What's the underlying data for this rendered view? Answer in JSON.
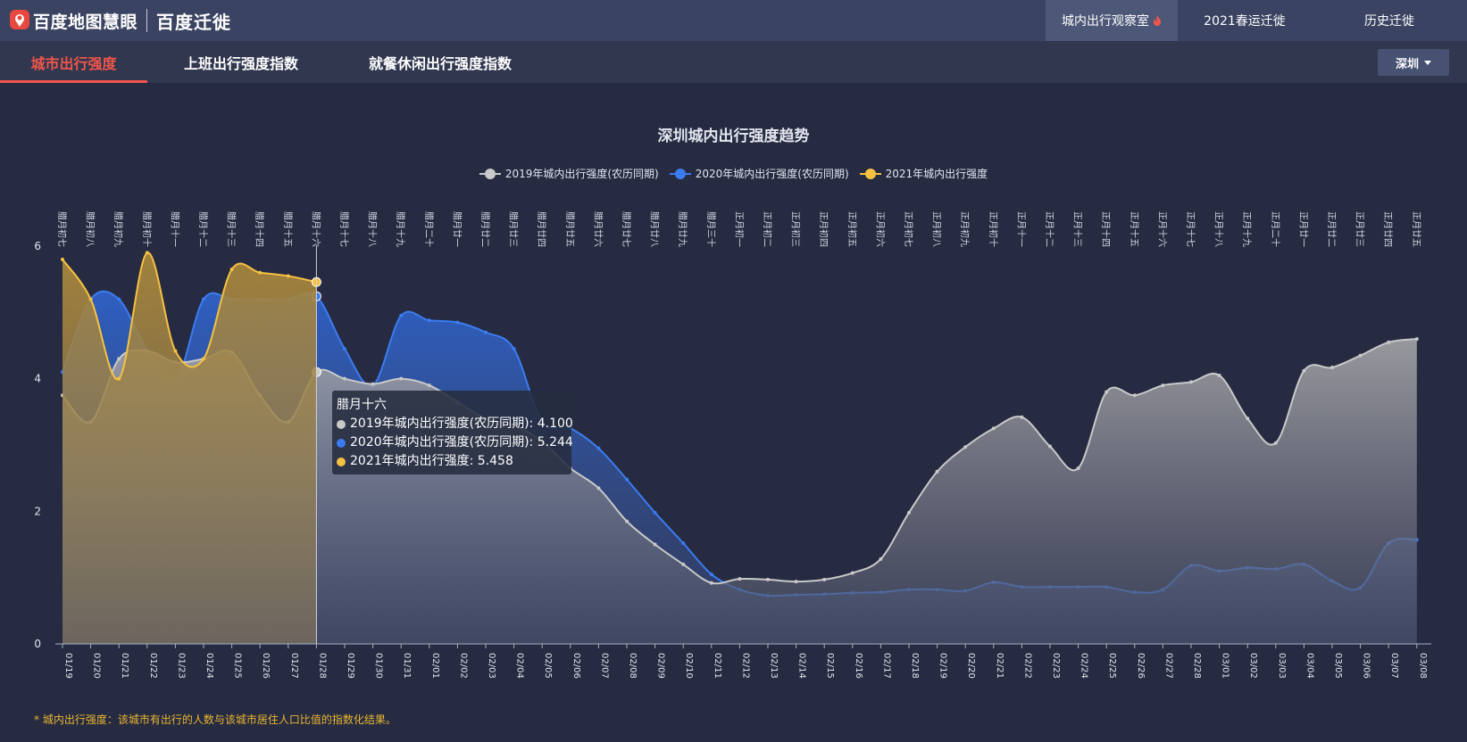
{
  "header": {
    "logo_text": "百度地图慧眼",
    "product_name": "百度迁徙",
    "nav": [
      {
        "label": "城内出行观察室",
        "active": true
      },
      {
        "label": "2021春运迁徙",
        "active": false
      },
      {
        "label": "历史迁徙",
        "active": false
      }
    ]
  },
  "tabs": [
    {
      "label": "城市出行强度",
      "active": true
    },
    {
      "label": "上班出行强度指数",
      "active": false
    },
    {
      "label": "就餐休闲出行强度指数",
      "active": false
    }
  ],
  "city_select": {
    "value": "深圳"
  },
  "colors": {
    "s2019": "#c9c9c9",
    "s2020": "#3b7cf0",
    "s2021": "#f5c142",
    "accent": "#f0564b"
  },
  "tooltip": {
    "title": "腊月十六",
    "rows": [
      {
        "text": "2019年城内出行强度(农历同期): 4.100",
        "color": "#c9c9c9"
      },
      {
        "text": "2020年城内出行强度(农历同期): 5.244",
        "color": "#3b7cf0"
      },
      {
        "text": "2021年城内出行强度: 5.458",
        "color": "#f5c142"
      }
    ]
  },
  "footnote": "* 城内出行强度：该城市有出行的人数与该城市居住人口比值的指数化结果。",
  "chart_data": {
    "type": "area",
    "title": "深圳城内出行强度趋势",
    "ylim": [
      0,
      6
    ],
    "yticks": [
      0,
      2,
      4,
      6
    ],
    "legend_position": "top-center",
    "grid": false,
    "categories": [
      "01/19",
      "01/20",
      "01/21",
      "01/22",
      "01/23",
      "01/24",
      "01/25",
      "01/26",
      "01/27",
      "01/28",
      "01/29",
      "01/30",
      "01/31",
      "02/01",
      "02/02",
      "02/03",
      "02/04",
      "02/05",
      "02/06",
      "02/07",
      "02/08",
      "02/09",
      "02/10",
      "02/11",
      "02/12",
      "02/13",
      "02/14",
      "02/15",
      "02/16",
      "02/17",
      "02/18",
      "02/19",
      "02/20",
      "02/21",
      "02/22",
      "02/23",
      "02/24",
      "02/25",
      "02/26",
      "02/27",
      "02/28",
      "03/01",
      "03/02",
      "03/03",
      "03/04",
      "03/05",
      "03/06",
      "03/07",
      "03/08"
    ],
    "lunar_labels": [
      "腊月初七",
      "腊月初八",
      "腊月初九",
      "腊月初十",
      "腊月十一",
      "腊月十二",
      "腊月十三",
      "腊月十四",
      "腊月十五",
      "腊月十六",
      "腊月十七",
      "腊月十八",
      "腊月十九",
      "腊月二十",
      "腊月廿一",
      "腊月廿二",
      "腊月廿三",
      "腊月廿四",
      "腊月廿五",
      "腊月廿六",
      "腊月廿七",
      "腊月廿八",
      "腊月廿九",
      "腊月三十",
      "正月初一",
      "正月初二",
      "正月初三",
      "正月初四",
      "正月初五",
      "正月初六",
      "正月初七",
      "正月初八",
      "正月初九",
      "正月初十",
      "正月十一",
      "正月十二",
      "正月十三",
      "正月十四",
      "正月十五",
      "正月十六",
      "正月十七",
      "正月十八",
      "正月十九",
      "正月二十",
      "正月廿一",
      "正月廿二",
      "正月廿三",
      "正月廿四",
      "正月廿五"
    ],
    "highlight_index": 9,
    "series": [
      {
        "name": "2019年城内出行强度(农历同期)",
        "key": "s2019",
        "values": [
          3.75,
          3.35,
          4.3,
          4.42,
          4.25,
          4.3,
          4.4,
          3.75,
          3.35,
          4.1,
          4.0,
          3.92,
          4.0,
          3.9,
          3.65,
          3.4,
          3.3,
          3.05,
          2.65,
          2.35,
          1.85,
          1.5,
          1.2,
          0.92,
          0.98,
          0.97,
          0.94,
          0.97,
          1.07,
          1.28,
          1.98,
          2.6,
          2.97,
          3.25,
          3.42,
          2.98,
          2.65,
          3.8,
          3.75,
          3.9,
          3.95,
          4.05,
          3.4,
          3.03,
          4.12,
          4.17,
          4.35,
          4.55,
          4.6
        ]
      },
      {
        "name": "2020年城内出行强度(农历同期)",
        "key": "s2020",
        "values": [
          4.1,
          5.2,
          5.2,
          4.42,
          3.95,
          5.2,
          5.2,
          5.2,
          5.2,
          5.244,
          4.45,
          3.9,
          4.95,
          4.88,
          4.85,
          4.7,
          4.45,
          3.35,
          3.25,
          2.95,
          2.48,
          1.98,
          1.52,
          1.05,
          0.82,
          0.73,
          0.74,
          0.75,
          0.77,
          0.78,
          0.82,
          0.82,
          0.8,
          0.93,
          0.86,
          0.86,
          0.86,
          0.86,
          0.78,
          0.82,
          1.18,
          1.1,
          1.15,
          1.13,
          1.2,
          0.95,
          0.85,
          1.52,
          1.57
        ]
      },
      {
        "name": "2021年城内出行强度",
        "key": "s2021",
        "values": [
          5.8,
          5.2,
          4.0,
          5.9,
          4.42,
          4.3,
          5.65,
          5.6,
          5.55,
          5.458
        ]
      }
    ]
  }
}
